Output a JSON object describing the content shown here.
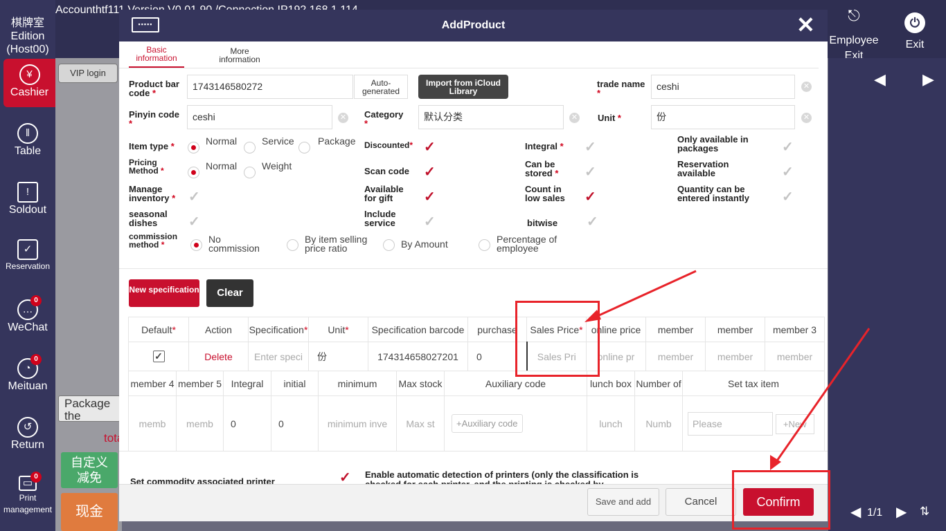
{
  "sidebar": {
    "store": "棋牌室",
    "edition": "Edition",
    "host": "(Host00)",
    "items": [
      {
        "label": "Cashier"
      },
      {
        "label": "Table"
      },
      {
        "label": "Soldout"
      },
      {
        "label": "Reservation"
      },
      {
        "label": "WeChat",
        "badge": "0"
      },
      {
        "label": "Meituan",
        "badge": "0"
      },
      {
        "label": "Return"
      },
      {
        "label": "Print management",
        "badge": "0"
      }
    ]
  },
  "topbar": {
    "account": "Accounthtf111 Version V0.01.90 /Connection IP192.168.1.114",
    "employee": "Employee",
    "employee_exit": "Exit",
    "exit": "Exit"
  },
  "background": {
    "vip": "VIP login",
    "package": "Package the",
    "total": "tota",
    "custom_discount": "自定义减免",
    "cash": "现金",
    "pagination": "1/1"
  },
  "modal": {
    "title": "AddProduct",
    "tabs": [
      "Basic information",
      "More information"
    ],
    "barcode": {
      "label": "Product bar code",
      "value": "1743146580272",
      "auto": "Auto-generated"
    },
    "import": "Import from iCloud Library",
    "trade_name": {
      "label": "trade name",
      "value": "ceshi"
    },
    "pinyin": {
      "label": "Pinyin code",
      "value": "ceshi"
    },
    "category": {
      "label": "Category",
      "value": "默认分类"
    },
    "unit": {
      "label": "Unit",
      "value": "份"
    },
    "item_type": {
      "label": "Item type",
      "options": [
        "Normal",
        "Service",
        "Package"
      ]
    },
    "pricing": {
      "label": "Pricing Method",
      "options": [
        "Normal",
        "Weight"
      ]
    },
    "manage_inventory": "Manage inventory",
    "seasonal": "seasonal dishes",
    "discounted": "Discounted",
    "scan_code": "Scan code",
    "gift": "Available for gift",
    "include_service": "Include service",
    "integral": "Integral",
    "stored": "Can be stored",
    "low_sales": "Count in low sales",
    "bitwise": "bitwise",
    "only_packages": "Only available in packages",
    "reservation": "Reservation available",
    "quantity_instant": "Quantity can be entered instantly",
    "commission": {
      "label": "commission method",
      "options": [
        "No commission",
        "By item selling price ratio",
        "By Amount",
        "Percentage of employee"
      ]
    },
    "new_spec": "New specification",
    "clear": "Clear",
    "table1": {
      "headers": [
        "Default",
        "Action",
        "Specification",
        "Unit",
        "Specification barcode",
        "purchase",
        "Sales Price",
        "online price",
        "member",
        "member",
        "member 3"
      ],
      "row": {
        "delete": "Delete",
        "spec_ph": "Enter speci",
        "unit": "份",
        "barcode": "174314658027201",
        "purchase": "0",
        "sales_ph": "Sales Pri",
        "online_ph": "online pr",
        "member_ph": "member"
      }
    },
    "table2": {
      "headers": [
        "member 4",
        "member 5",
        "Integral",
        "initial",
        "minimum",
        "Max stock",
        "Auxiliary code",
        "lunch box",
        "Number of",
        "Set tax item"
      ],
      "row": {
        "memb": "memb",
        "integral": "0",
        "initial": "0",
        "minimum": "minimum inve",
        "max": "Max st",
        "aux": "+Auxiliary code",
        "lunch": "lunch",
        "number": "Numb",
        "please": "Please",
        "new": "+New"
      }
    },
    "printer_title": "Set commodity associated printer",
    "printer_text": "Enable automatic detection of printers (only the classification is checked for each printer, and the printing is checked by",
    "save_add": "Save and add",
    "cancel": "Cancel",
    "confirm": "Confirm"
  }
}
